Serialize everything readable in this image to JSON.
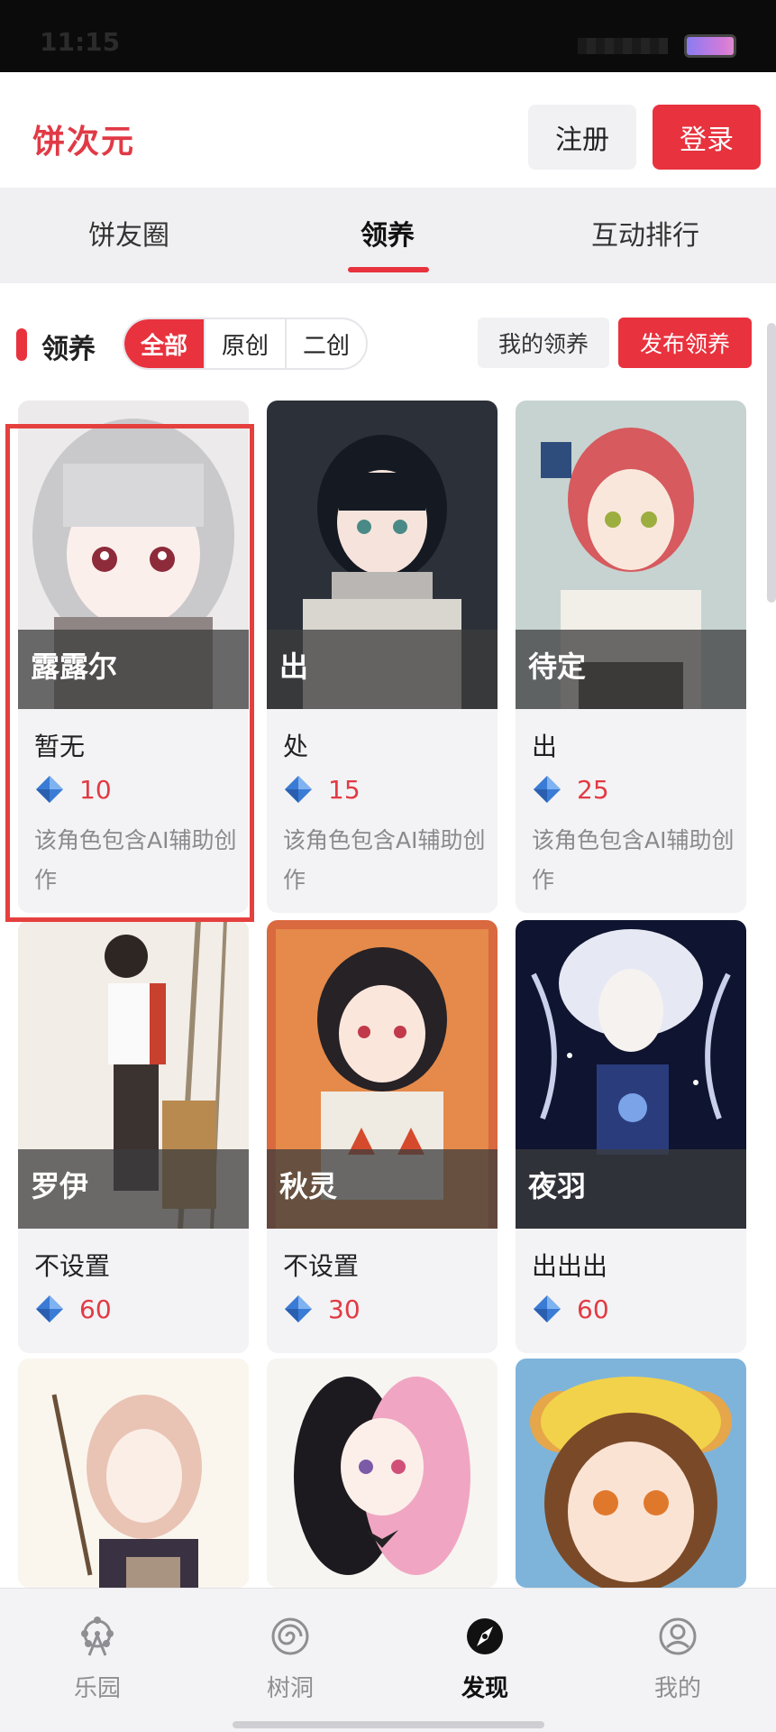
{
  "status": {
    "time": "11:15"
  },
  "header": {
    "logo": "饼次元",
    "register_label": "注册",
    "login_label": "登录"
  },
  "tabs": [
    {
      "label": "饼友圈"
    },
    {
      "label": "领养"
    },
    {
      "label": "互动排行"
    }
  ],
  "filter": {
    "title": "领养",
    "segments": [
      "全部",
      "原创",
      "二创"
    ],
    "my_adoption": "我的领养",
    "publish_adoption": "发布领养"
  },
  "cards": [
    {
      "name": "露露尔",
      "desc": "暂无",
      "price": "10",
      "note": "该角色包含AI辅助创作"
    },
    {
      "name": "出",
      "desc": "处",
      "price": "15",
      "note": "该角色包含AI辅助创作"
    },
    {
      "name": "待定",
      "desc": "出",
      "price": "25",
      "note": "该角色包含AI辅助创作"
    },
    {
      "name": "罗伊",
      "desc": "不设置",
      "price": "60"
    },
    {
      "name": "秋灵",
      "desc": "不设置",
      "price": "30"
    },
    {
      "name": "夜羽",
      "desc": "出出出",
      "price": "60"
    }
  ],
  "bottom_nav": [
    {
      "label": "乐园",
      "icon": "ferris-wheel-icon"
    },
    {
      "label": "树洞",
      "icon": "swirl-icon"
    },
    {
      "label": "发现",
      "icon": "compass-icon"
    },
    {
      "label": "我的",
      "icon": "user-icon"
    }
  ],
  "colors": {
    "accent": "#e8323e",
    "price": "#e23a44",
    "gem": "#3a7bd5"
  }
}
